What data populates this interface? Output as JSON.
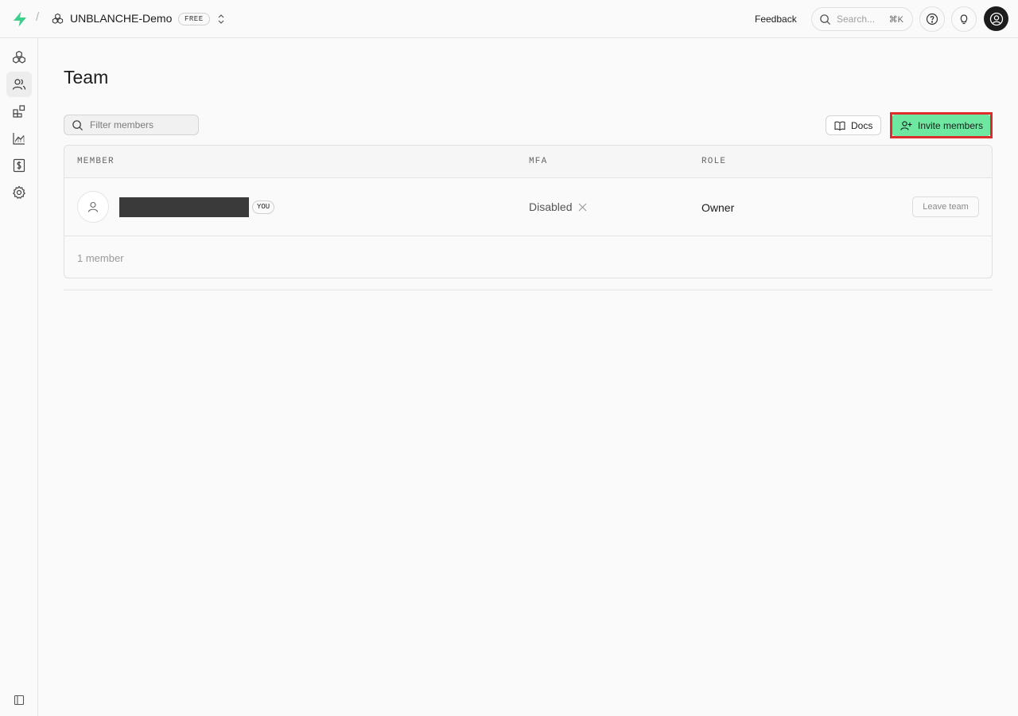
{
  "header": {
    "org_name": "UNBLANCHE-Demo",
    "plan_badge": "FREE",
    "feedback_label": "Feedback",
    "search_placeholder": "Search...",
    "search_shortcut": "⌘K"
  },
  "sidebar": {
    "items": [
      {
        "name": "projects",
        "icon": "cube-cluster-icon",
        "active": false
      },
      {
        "name": "team",
        "icon": "users-icon",
        "active": true
      },
      {
        "name": "integrations",
        "icon": "blocks-icon",
        "active": false
      },
      {
        "name": "usage",
        "icon": "chart-icon",
        "active": false
      },
      {
        "name": "billing",
        "icon": "dollar-icon",
        "active": false
      },
      {
        "name": "settings",
        "icon": "gear-icon",
        "active": false
      }
    ]
  },
  "main": {
    "title": "Team",
    "filter_placeholder": "Filter members",
    "docs_label": "Docs",
    "invite_label": "Invite members",
    "table": {
      "columns": [
        "MEMBER",
        "MFA",
        "ROLE"
      ],
      "rows": [
        {
          "name": "",
          "you_badge": "YOU",
          "mfa": "Disabled",
          "role": "Owner",
          "action": "Leave team"
        }
      ],
      "footer": "1 member"
    }
  },
  "colors": {
    "brand": "#3ecf8e",
    "invite_button": "#6ee7a0",
    "highlight": "#dc2c2c"
  }
}
